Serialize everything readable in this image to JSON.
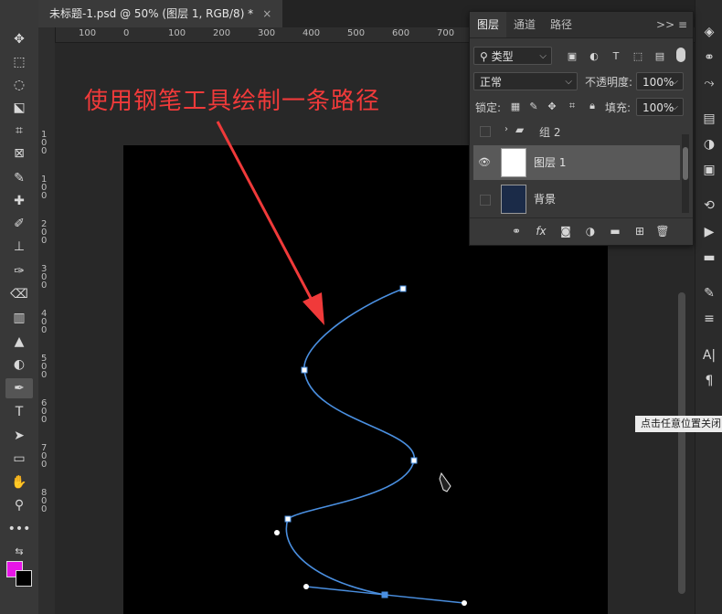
{
  "document": {
    "tab_title": "未标题-1.psd @ 50% (图层 1, RGB/8) *",
    "close_glyph": "×"
  },
  "annotation": {
    "text": "使用钢笔工具绘制一条路径",
    "color": "#f03a3a"
  },
  "rulers": {
    "top_labels": [
      "100",
      "0",
      "100",
      "200",
      "300",
      "400",
      "500",
      "600",
      "700"
    ],
    "left_labels": [
      "1",
      "0",
      "0",
      "1",
      "0",
      "0",
      "2",
      "0",
      "0",
      "3",
      "0",
      "0",
      "4",
      "0",
      "0",
      "5",
      "0",
      "0",
      "6",
      "0",
      "0",
      "7",
      "0",
      "0",
      "8",
      "0",
      "0"
    ]
  },
  "layers_panel": {
    "tabs": [
      "图层",
      "通道",
      "路径"
    ],
    "active_tab": "图层",
    "menu_glyphs": ">>  ≡",
    "filter_select": "类型",
    "blend_mode": "正常",
    "opacity_label": "不透明度:",
    "opacity_value": "100%",
    "lock_label": "锁定:",
    "fill_label": "填充:",
    "fill_value": "100%",
    "layers": [
      {
        "name": "组 2",
        "type": "group",
        "visible": false
      },
      {
        "name": "图层 1",
        "type": "layer",
        "visible": true,
        "selected": true
      },
      {
        "name": "背景",
        "type": "background",
        "visible": false
      }
    ]
  },
  "tooltip": {
    "text": "点击任意位置关闭"
  },
  "colors": {
    "foreground": "#e815e8",
    "background": "#000000",
    "path_stroke": "#4a8fe0",
    "anchor": "#ffffff"
  }
}
